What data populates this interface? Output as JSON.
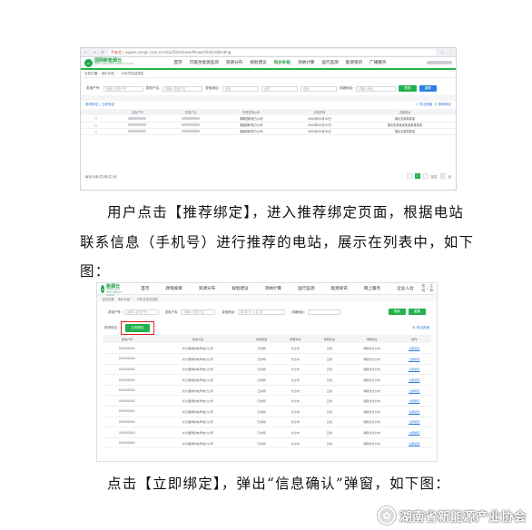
{
  "screenshot1": {
    "browser": {
      "security_label": "不安全",
      "url": "vgwec.zxvgc.com.cn/vibu/DistributedPowerStationBinding"
    },
    "logo": {
      "name": "国网新能源云",
      "sub": "STATE GRID NEW ENERGY CLOUD"
    },
    "nav": [
      "首页",
      "可再生能源监测",
      "资源分布",
      "规划建议",
      "电价补贴",
      "消纳计算",
      "运行监测",
      "能源资讯",
      "广播服务"
    ],
    "breadcrumb": [
      "当前位置:",
      "电价补贴",
      "分布式电站绑定"
    ],
    "filters": [
      {
        "label": "发电户号:",
        "placeholder": "请输入发电户号"
      },
      {
        "label": "发电户名:",
        "placeholder": "请输入发电户名"
      },
      {
        "label": "发电地址:",
        "placeholder": "全部"
      },
      {
        "label": "",
        "placeholder": "全部"
      },
      {
        "label": "",
        "placeholder": "全部"
      },
      {
        "label": "详细地址:",
        "placeholder": "请输入地址"
      }
    ],
    "search_button": "搜索",
    "reset_button": "重置",
    "toolbar": {
      "left": "推荐绑定 | 立即绑定",
      "actions": [
        "+ 导出表格",
        "⟳ 推荐绑定"
      ]
    },
    "columns": [
      "发电户号",
      "发电户名",
      "所属供电公司",
      "并网时间",
      "详细地址"
    ],
    "rows": [
      [
        "",
        "",
        "湖南国网电力公司",
        "0000年00月00日",
        "湖北省某某某某"
      ],
      [
        "",
        "",
        "湖南国网电力公司",
        "0000年00月00日",
        "湖北省某某某某某某某某某"
      ],
      [
        "",
        "",
        "湖南国网电力公司",
        "0000年00月00日",
        "湖北省某某某某"
      ]
    ],
    "pager": {
      "summary": "每页10条/共3条/共1页",
      "current": "1",
      "goto": "前往",
      "page": "1",
      "unit": "页"
    }
  },
  "para1": {
    "line1": "用户点击【推荐绑定】，进入推荐绑定页面，根据电站",
    "line2": "联系信息（手机号）进行推荐的电站，展示在列表中，如下",
    "line3": "图："
  },
  "screenshot2": {
    "logo": {
      "name": "国网新能源云",
      "sub": "STATE GRID NEW ENERGY CLOUD"
    },
    "nav": [
      "首页",
      "政策规章",
      "资源分布",
      "规划建议",
      "消纳计算",
      "运行监测",
      "能源资讯",
      "网上服务",
      "企业入驻"
    ],
    "user": [
      "登陆",
      "注册"
    ],
    "breadcrumb": [
      "当前位置:",
      "电价补贴",
      "分布式电站绑定"
    ],
    "filters": [
      {
        "label": "发电户号:",
        "placeholder": "请输入发电户号"
      },
      {
        "label": "发电户名:",
        "placeholder": "请输入发电户名"
      },
      {
        "label": "发电地址:",
        "placeholder": "湖 南 长 沙 区 县"
      },
      {
        "label": "详细地址:",
        "placeholder": ""
      }
    ],
    "search_button": "搜索",
    "reset_button": "重置",
    "tab_label": "推荐绑定",
    "bind_button": "立即绑定",
    "export_label": "导出表格",
    "columns": [
      "发电户号",
      "发电户名",
      "并网类型",
      "所属地市",
      "并网状态",
      "详细地址",
      "操作"
    ],
    "rows": [
      [
        "000000000",
        "长沙国网供电局电力公司",
        "已并网",
        "长沙市",
        "正常",
        "湖南省长沙市",
        "立即绑定"
      ],
      [
        "000000000",
        "长沙国网供电局电力公司",
        "已并网",
        "长沙市",
        "正常",
        "湖南省长沙市",
        "立即绑定"
      ],
      [
        "000000000",
        "长沙国网供电局电力公司",
        "已并网",
        "长沙市",
        "正常",
        "湖南省长沙市",
        "立即绑定"
      ],
      [
        "000000000",
        "长沙国网供电局电力公司",
        "已并网",
        "长沙市",
        "正常",
        "湖南省长沙市",
        "立即绑定"
      ],
      [
        "000000000",
        "长沙国网供电局电力公司",
        "已并网",
        "长沙市",
        "正常",
        "湖南省长沙市",
        "立即绑定"
      ],
      [
        "000000000",
        "长沙国网供电局电力公司",
        "已并网",
        "长沙市",
        "正常",
        "湖南省长沙市",
        "立即绑定"
      ],
      [
        "000000000",
        "长沙国网供电局电力公司",
        "已并网",
        "长沙市",
        "正常",
        "湖南省长沙市",
        "立即绑定"
      ],
      [
        "000000000",
        "长沙国网供电局电力公司",
        "已并网",
        "长沙市",
        "正常",
        "湖南省长沙市",
        "立即绑定"
      ],
      [
        "000000000",
        "长沙国网供电局电力公司",
        "已并网",
        "长沙市",
        "正常",
        "湖南省长沙市",
        "立即绑定"
      ],
      [
        "000000000",
        "长沙国网供电局电力公司",
        "已并网",
        "长沙市",
        "正常",
        "湖南省长沙市",
        "立即绑定"
      ]
    ]
  },
  "para2": {
    "line1": "点击【立即绑定】，弹出“信息确认”弹窗，如下图："
  },
  "watermark": {
    "text": "湖南省新能源产业协会",
    "icon": "wechat-icon"
  },
  "colors": {
    "brand_green": "#22b14c",
    "link_blue": "#2f7fe0",
    "highlight_red": "#e02020"
  }
}
